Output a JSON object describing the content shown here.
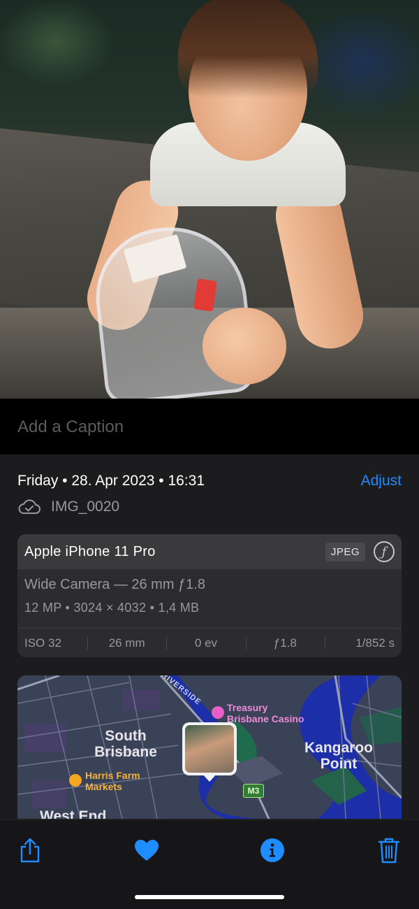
{
  "caption": {
    "placeholder": "Add a Caption"
  },
  "meta": {
    "date": "Friday • 28. Apr 2023 • 16:31",
    "adjust_label": "Adjust",
    "filename": "IMG_0020"
  },
  "camera": {
    "model": "Apple iPhone 11 Pro",
    "format_badge": "JPEG",
    "lens": "Wide Camera — 26 mm ƒ1.8",
    "resolution": "12 MP  •  3024 × 4032  •  1,4 MB",
    "specs": {
      "iso": "ISO 32",
      "focal": "26 mm",
      "ev": "0 ev",
      "aperture": "ƒ1.8",
      "shutter": "1/852 s"
    }
  },
  "map": {
    "labels": {
      "south_brisbane": "South\nBrisbane",
      "south_line1": "South",
      "south_line2": "Brisbane",
      "kangaroo_line1": "Kangaroo",
      "kangaroo_line2": "Point",
      "harris_line1": "Harris Farm",
      "harris_line2": "Markets",
      "treasury_line1": "Treasury",
      "treasury_line2": "Brisbane Casino",
      "west_end": "West End",
      "riverside": "RIVERSIDE",
      "motorway": "M3"
    }
  },
  "toolbar": {
    "icons": [
      "share-icon",
      "heart-icon",
      "info-icon",
      "trash-icon"
    ]
  },
  "colors": {
    "accent": "#1f8dff",
    "panel": "#1c1c1e",
    "card": "#2c2c2e"
  }
}
